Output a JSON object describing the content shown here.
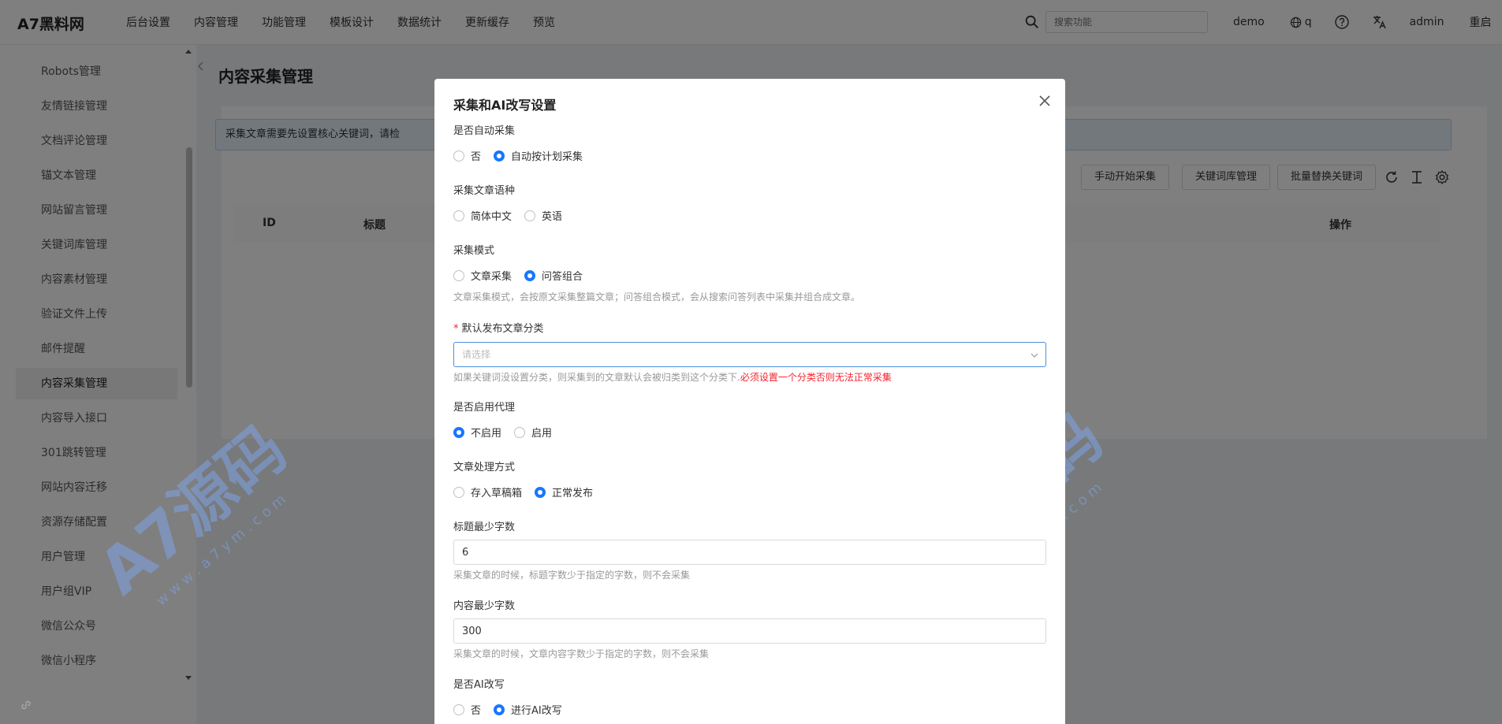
{
  "app": {
    "brand": "A7黑料网"
  },
  "topnav": [
    "后台设置",
    "内容管理",
    "功能管理",
    "模板设计",
    "数据统计",
    "更新缓存",
    "预览"
  ],
  "topright": {
    "search_placeholder": "搜索功能",
    "site": "demo",
    "lang": "q",
    "user": "admin",
    "restart": "重启"
  },
  "sidebar": {
    "items": [
      "Robots管理",
      "友情链接管理",
      "文档评论管理",
      "锚文本管理",
      "网站留言管理",
      "关键词库管理",
      "内容素材管理",
      "验证文件上传",
      "邮件提醒",
      "内容采集管理",
      "内容导入接口",
      "301跳转管理",
      "网站内容迁移",
      "资源存储配置",
      "用户管理",
      "用户组VIP",
      "微信公众号",
      "微信小程序"
    ],
    "active": "内容采集管理"
  },
  "main": {
    "title": "内容采集管理",
    "alert": "采集文章需要先设置核心关键词，请检",
    "toolbar": [
      "手动开始采集",
      "关键词库管理",
      "批量替换关键词"
    ],
    "table_headers": {
      "id": "ID",
      "title": "标题",
      "actions": "操作"
    }
  },
  "dialog": {
    "title": "采集和AI改写设置",
    "auto_collect": {
      "label": "是否自动采集",
      "options": [
        "否",
        "自动按计划采集"
      ],
      "selected": 1
    },
    "language": {
      "label": "采集文章语种",
      "options": [
        "简体中文",
        "英语"
      ],
      "selected": -1
    },
    "mode": {
      "label": "采集模式",
      "options": [
        "文章采集",
        "问答组合"
      ],
      "selected": 1,
      "help": "文章采集模式，会按原文采集整篇文章；问答组合模式，会从搜索问答列表中采集并组合成文章。"
    },
    "category": {
      "label": "默认发布文章分类",
      "placeholder": "请选择",
      "help": "如果关键词没设置分类，则采集到的文章默认会被归类到这个分类下.",
      "warning": "必须设置一个分类否则无法正常采集"
    },
    "proxy": {
      "label": "是否启用代理",
      "options": [
        "不启用",
        "启用"
      ],
      "selected": 0
    },
    "process": {
      "label": "文章处理方式",
      "options": [
        "存入草稿箱",
        "正常发布"
      ],
      "selected": 1
    },
    "title_min": {
      "label": "标题最少字数",
      "value": "6",
      "help": "采集文章的时候，标题字数少于指定的字数，则不会采集"
    },
    "content_min": {
      "label": "内容最少字数",
      "value": "300",
      "help": "采集文章的时候，文章内容字数少于指定的字数，则不会采集"
    },
    "ai_rewrite": {
      "label": "是否AI改写",
      "options": [
        "否",
        "进行AI改写"
      ],
      "selected": 1
    }
  },
  "watermark": {
    "logo": "A7源码",
    "url": "w w w . a 7 y m . c o m"
  },
  "colors": {
    "accent": "#1677ff",
    "warning": "#f5222d",
    "watermark": "#7fa3e8"
  }
}
